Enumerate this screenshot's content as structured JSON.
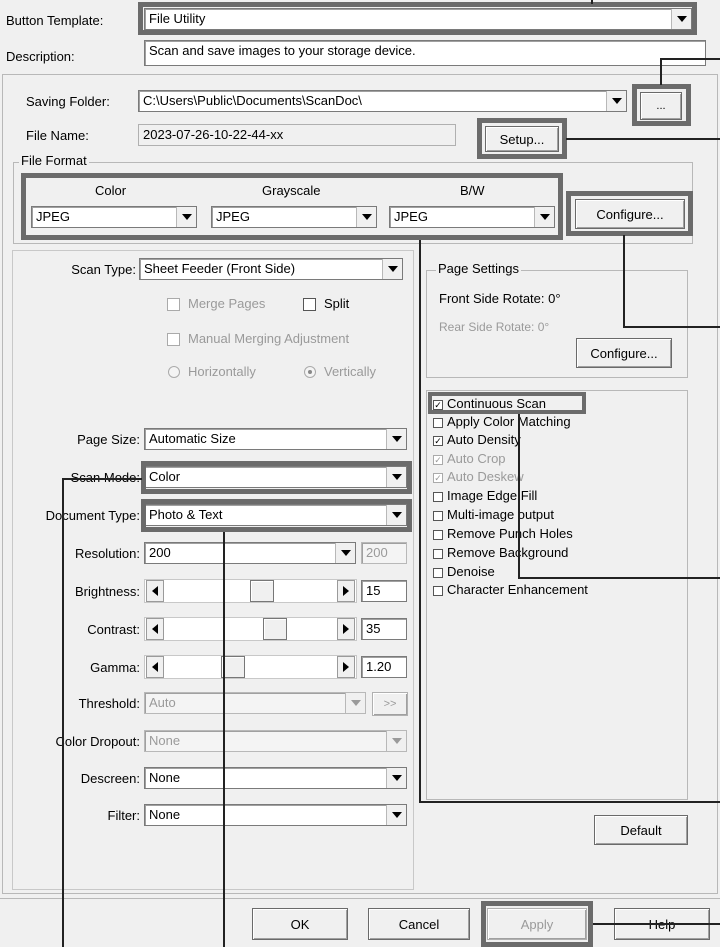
{
  "header": {
    "button_template_label": "Button Template:",
    "button_template_value": "File Utility",
    "description_label": "Description:",
    "description_value": "Scan and save images to your storage device."
  },
  "saving": {
    "folder_label": "Saving Folder:",
    "folder_value": "C:\\Users\\Public\\Documents\\ScanDoc\\",
    "browse_label": "...",
    "file_name_label": "File Name:",
    "file_name_value": "2023-07-26-10-22-44-xx",
    "setup_label": "Setup..."
  },
  "file_format": {
    "title": "File Format",
    "color_label": "Color",
    "gray_label": "Grayscale",
    "bw_label": "B/W",
    "color_value": "JPEG",
    "gray_value": "JPEG",
    "bw_value": "JPEG",
    "configure_label": "Configure..."
  },
  "scan": {
    "scan_type_label": "Scan Type:",
    "scan_type_value": "Sheet Feeder (Front Side)",
    "merge_pages": "Merge Pages",
    "split": "Split",
    "manual_merge": "Manual Merging Adjustment",
    "horizontally": "Horizontally",
    "vertically": "Vertically",
    "page_size_label": "Page Size:",
    "page_size_value": "Automatic Size",
    "scan_mode_label": "Scan Mode:",
    "scan_mode_value": "Color",
    "doc_type_label": "Document Type:",
    "doc_type_value": "Photo & Text",
    "resolution_label": "Resolution:",
    "resolution_value": "200",
    "resolution_custom": "200",
    "brightness_label": "Brightness:",
    "brightness_value": "15",
    "contrast_label": "Contrast:",
    "contrast_value": "35",
    "gamma_label": "Gamma:",
    "gamma_value": "1.20",
    "threshold_label": "Threshold:",
    "threshold_value": "Auto",
    "threshold_btn": ">>",
    "dropout_label": "Color Dropout:",
    "dropout_value": "None",
    "descreen_label": "Descreen:",
    "descreen_value": "None",
    "filter_label": "Filter:",
    "filter_value": "None"
  },
  "page_settings": {
    "title": "Page Settings",
    "front_rotate": "Front Side Rotate: 0°",
    "rear_rotate": "Rear Side Rotate: 0°",
    "configure_label": "Configure..."
  },
  "options": [
    {
      "label": "Continuous Scan",
      "checked": true,
      "disabled": false
    },
    {
      "label": "Apply Color Matching",
      "checked": false,
      "disabled": false
    },
    {
      "label": "Auto Density",
      "checked": true,
      "disabled": false
    },
    {
      "label": "Auto Crop",
      "checked": true,
      "disabled": true
    },
    {
      "label": "Auto Deskew",
      "checked": true,
      "disabled": true
    },
    {
      "label": "Image Edge Fill",
      "checked": false,
      "disabled": false
    },
    {
      "label": "Multi-image output",
      "checked": false,
      "disabled": false
    },
    {
      "label": "Remove Punch Holes",
      "checked": false,
      "disabled": false
    },
    {
      "label": "Remove Background",
      "checked": false,
      "disabled": false
    },
    {
      "label": "Denoise",
      "checked": false,
      "disabled": false
    },
    {
      "label": "Character Enhancement",
      "checked": false,
      "disabled": false
    }
  ],
  "footer": {
    "default_label": "Default",
    "ok_label": "OK",
    "cancel_label": "Cancel",
    "apply_label": "Apply",
    "help_label": "Help"
  },
  "slider_levels": {
    "brightness": 0.58,
    "contrast": 0.67,
    "gamma": 0.38
  },
  "colors": {
    "callout_border": "#6b6b6b",
    "window_bg": "#f0f0f0"
  }
}
